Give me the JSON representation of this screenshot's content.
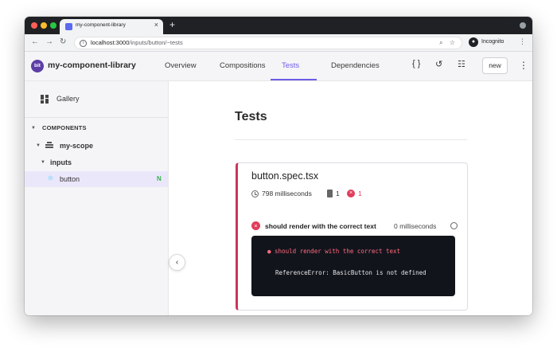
{
  "browser": {
    "tab_title": "my-component-library",
    "new_tab_symbol": "+",
    "url_host": "localhost:3000",
    "url_path": "/inputs/button/~tests",
    "profile_label": "Incognito"
  },
  "header": {
    "logo_text": "bit",
    "app_title": "my-component-library",
    "tabs": [
      "Overview",
      "Compositions",
      "Tests",
      "Dependencies"
    ],
    "active_tab": "Tests",
    "code_icon_symbol": "{ }",
    "new_button": "new"
  },
  "sidebar": {
    "gallery_label": "Gallery",
    "section_label": "COMPONENTS",
    "scope_label": "my-scope",
    "folder_label": "inputs",
    "component_label": "button",
    "component_badge": "N"
  },
  "main": {
    "page_title": "Tests",
    "card": {
      "file_name": "button.spec.tsx",
      "duration": "798 milliseconds",
      "file_count": "1",
      "fail_count": "1",
      "test_name": "should render with the correct text",
      "test_duration": "0 milliseconds",
      "error_line": "● should render with the correct text",
      "error_detail": "ReferenceError: BasicButton is not defined"
    }
  },
  "colors": {
    "accent": "#6c5ce7",
    "fail": "#e03e5a",
    "success": "#37b24d",
    "console_bg": "#12141c"
  }
}
